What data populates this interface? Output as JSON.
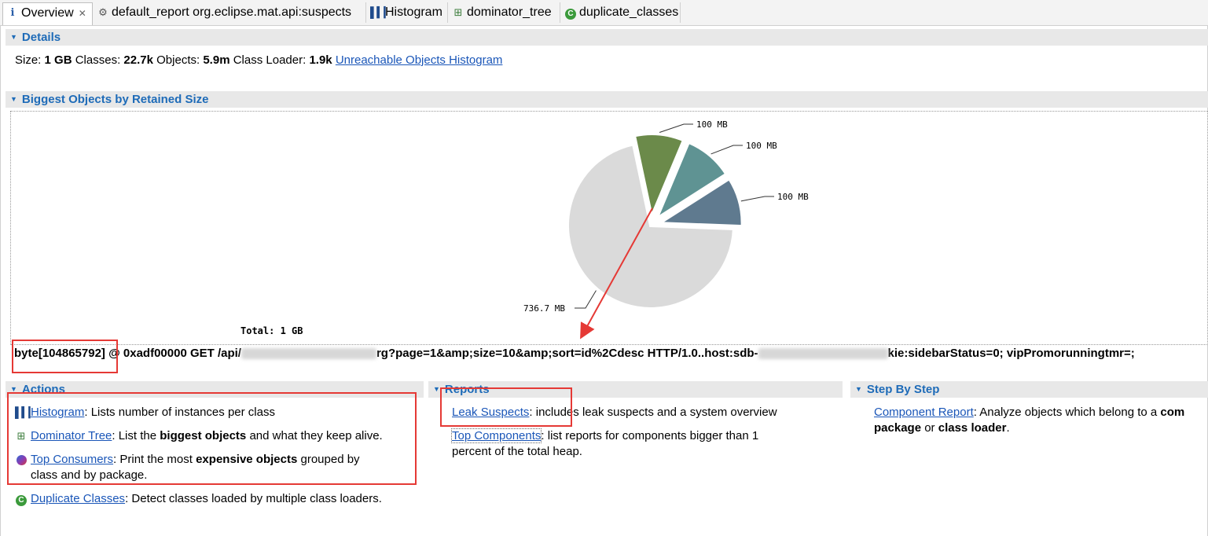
{
  "tabs": [
    {
      "label": "Overview",
      "icon": "info-icon",
      "active": true,
      "closable": true
    },
    {
      "label": "default_report  org.eclipse.mat.api:suspects",
      "icon": "report-icon"
    },
    {
      "label": "Histogram",
      "icon": "histogram-icon"
    },
    {
      "label": "dominator_tree",
      "icon": "dominator-tree-icon"
    },
    {
      "label": "duplicate_classes",
      "icon": "duplicate-classes-icon"
    }
  ],
  "details": {
    "heading": "Details",
    "size_label": "Size:",
    "size_value": "1 GB",
    "classes_label": "Classes:",
    "classes_value": "22.7k",
    "objects_label": "Objects:",
    "objects_value": "5.9m",
    "classloader_label": "Class Loader:",
    "classloader_value": "1.9k",
    "unreachable_link": "Unreachable Objects Histogram"
  },
  "biggest": {
    "heading": "Biggest Objects by Retained Size",
    "total_label": "Total: 1 GB",
    "selected_object": {
      "prefix": "byte[104865792]",
      "address": "@ 0xadf00000 GET /api/",
      "part2": "rg?page=1&amp;size=10&amp;sort=id%2Cdesc HTTP/1.0..host:sdb-",
      "part3": "kie:sidebarStatus=0; vipPromorunningtmr=;"
    }
  },
  "chart_data": {
    "type": "pie",
    "title": "",
    "total": "Total: 1 GB",
    "slices": [
      {
        "label": "100 MB",
        "value": 100,
        "color": "#6b8a4a",
        "exploded": true
      },
      {
        "label": "100 MB",
        "value": 100,
        "color": "#5f9393",
        "exploded": true
      },
      {
        "label": "100 MB",
        "value": 100,
        "color": "#5f7a8f",
        "exploded": true
      },
      {
        "label": "736.7 MB",
        "value": 736.7,
        "color": "#dadada",
        "exploded": false
      }
    ]
  },
  "actions": {
    "heading": "Actions",
    "items": [
      {
        "link": "Histogram",
        "text_before": ": Lists number of instances per class",
        "bold": "",
        "text_after": ""
      },
      {
        "link": "Dominator Tree",
        "text_before": ": List the ",
        "bold": "biggest objects",
        "text_after": " and what they keep alive."
      },
      {
        "link": "Top Consumers",
        "text_before": ": Print the most ",
        "bold": "expensive objects",
        "text_after": " grouped by",
        "line2": "class and by package."
      },
      {
        "link": "Duplicate Classes",
        "text_before": ": Detect classes loaded by multiple class loaders.",
        "bold": "",
        "text_after": ""
      }
    ]
  },
  "reports": {
    "heading": "Reports",
    "items": [
      {
        "link": "Leak Suspects",
        "text": ": includes leak suspects and a system overview"
      },
      {
        "link": "Top Components",
        "text": ": list reports for components bigger than 1",
        "line2": "percent of the total heap."
      }
    ]
  },
  "stepbystep": {
    "heading": "Step By Step",
    "items": [
      {
        "link": "Component Report",
        "text": ": Analyze objects which belong to a ",
        "bold_tail": "com",
        "line2_bold1": "package",
        "line2_mid": " or ",
        "line2_bold2": "class loader",
        "line2_end": "."
      }
    ]
  }
}
